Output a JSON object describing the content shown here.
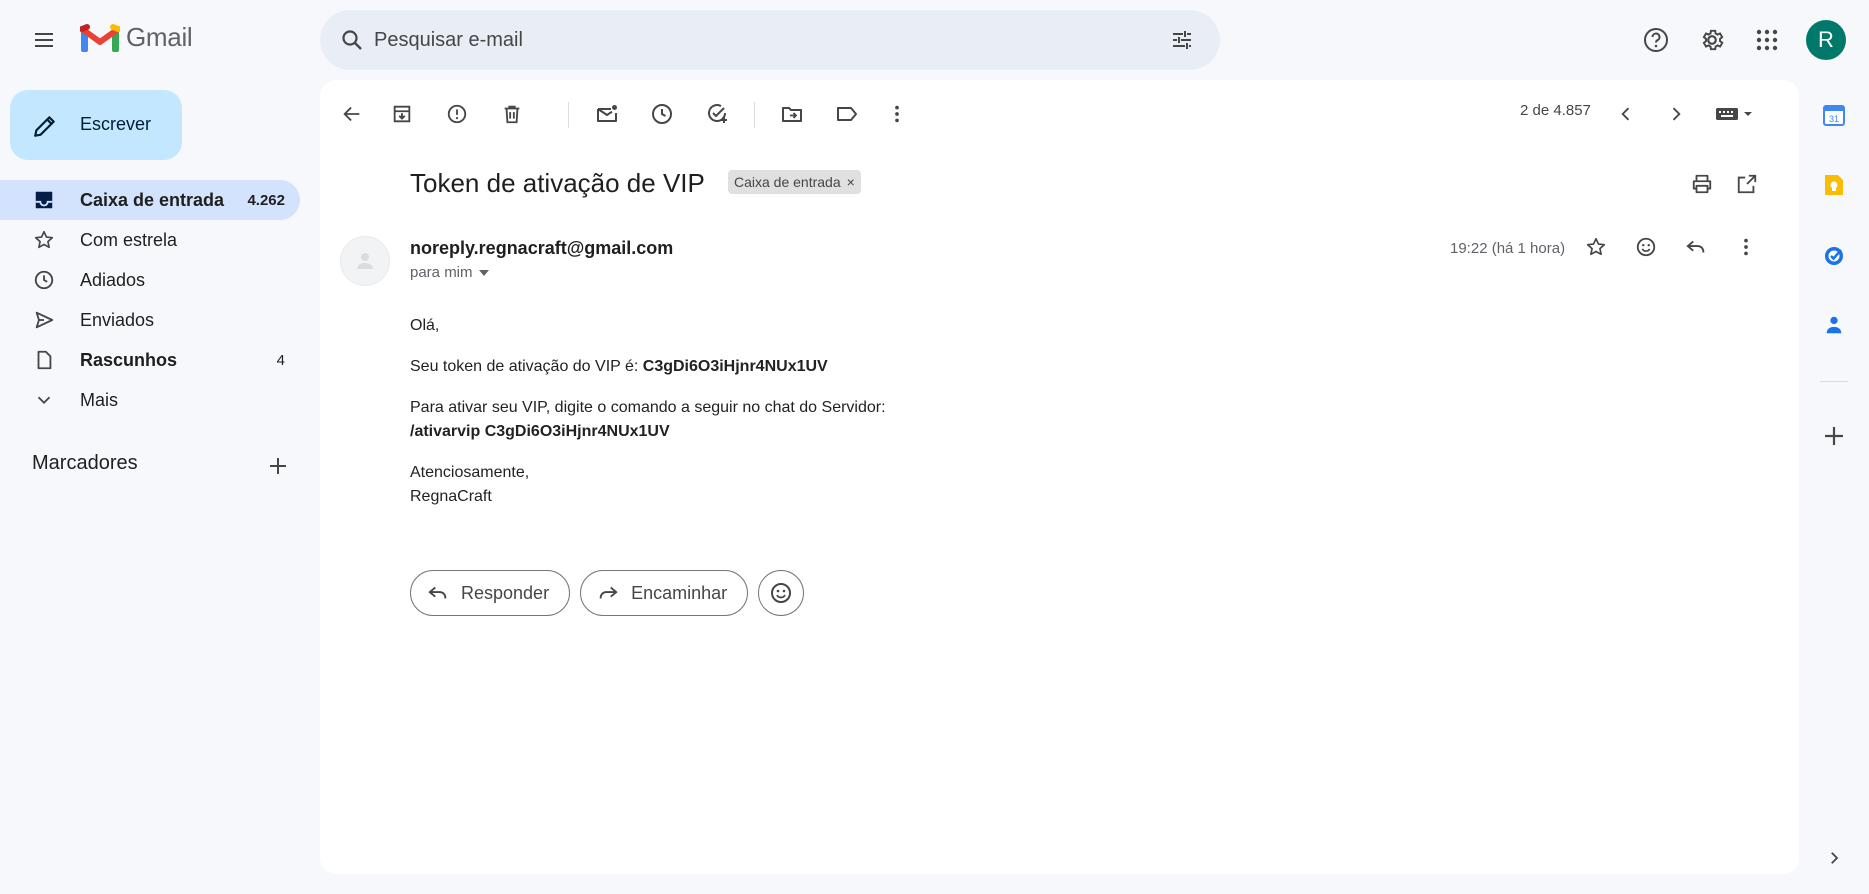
{
  "header": {
    "app_name": "Gmail",
    "search_placeholder": "Pesquisar e-mail",
    "avatar_initial": "R",
    "brand_colors": {
      "red": "#ea4335",
      "blue": "#4285f4",
      "green": "#34a853",
      "yellow": "#fbbc04"
    }
  },
  "sidebar": {
    "compose_label": "Escrever",
    "items": [
      {
        "label": "Caixa de entrada",
        "count": "4.262",
        "icon": "inbox-icon"
      },
      {
        "label": "Com estrela",
        "count": "",
        "icon": "star-icon"
      },
      {
        "label": "Adiados",
        "count": "",
        "icon": "clock-icon"
      },
      {
        "label": "Enviados",
        "count": "",
        "icon": "send-icon"
      },
      {
        "label": "Rascunhos",
        "count": "4",
        "icon": "draft-icon"
      },
      {
        "label": "Mais",
        "count": "",
        "icon": "chevron-down-icon"
      }
    ],
    "labels_header": "Marcadores"
  },
  "toolbar": {
    "pager": "2 de 4.857"
  },
  "email": {
    "subject": "Token de ativação de VIP",
    "tag": "Caixa de entrada",
    "tag_close": "×",
    "sender": "noreply.regnacraft@gmail.com",
    "to": "para mim",
    "time": "19:22 (há 1 hora)",
    "greeting": "Olá,",
    "line1_prefix": "Seu token de ativação do VIP é: ",
    "token": "C3gDi6O3iHjnr4NUx1UV",
    "line2": "Para ativar seu VIP, digite o comando a seguir no chat do Servidor:",
    "command": "/ativarvip C3gDi6O3iHjnr4NUx1UV",
    "closing": "Atenciosamente,",
    "signature": "RegnaCraft"
  },
  "actions": {
    "reply": "Responder",
    "forward": "Encaminhar"
  },
  "side_panel": {
    "calendar_day": "31"
  }
}
